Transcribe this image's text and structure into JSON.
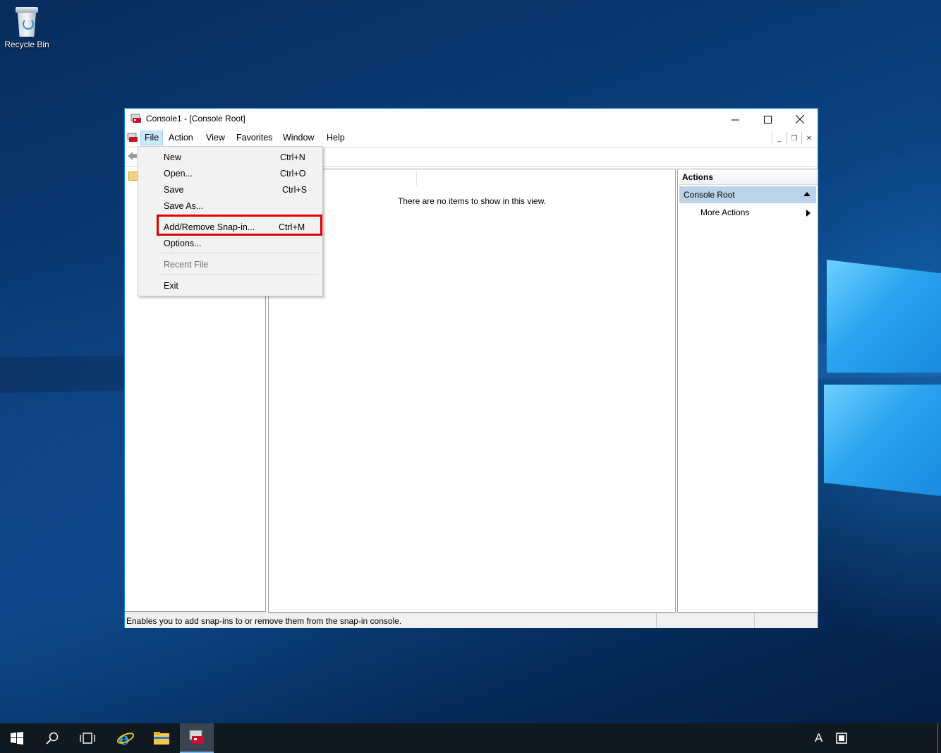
{
  "desktop": {
    "recycle_bin_label": "Recycle Bin"
  },
  "window": {
    "title": "Console1 - [Console Root]",
    "caption": {
      "minimize": "—",
      "maximize": "☐",
      "close": "✕"
    },
    "menu": [
      {
        "label": "File",
        "active": true
      },
      {
        "label": "Action"
      },
      {
        "label": "View"
      },
      {
        "label": "Favorites"
      },
      {
        "label": "Window"
      },
      {
        "label": "Help"
      }
    ],
    "empty_message": "There are no items to show in this view.",
    "actions": {
      "header": "Actions",
      "section": "Console Root",
      "more": "More Actions"
    },
    "status_text": "Enables you to add snap-ins to or remove them from the snap-in console."
  },
  "file_menu": {
    "items": [
      {
        "label": "New",
        "shortcut": "Ctrl+N"
      },
      {
        "label": "Open...",
        "shortcut": "Ctrl+O"
      },
      {
        "label": "Save",
        "shortcut": "Ctrl+S"
      },
      {
        "label": "Save As...",
        "shortcut": ""
      },
      {
        "label": "Add/Remove Snap-in...",
        "shortcut": "Ctrl+M",
        "highlighted": true
      },
      {
        "label": "Options...",
        "shortcut": ""
      },
      {
        "label": "Recent File",
        "shortcut": "",
        "disabled": true
      },
      {
        "label": "Exit",
        "shortcut": ""
      }
    ]
  },
  "taskbar": {
    "apps": [
      "start-icon",
      "search-icon",
      "task-view-icon",
      "internet-explorer-icon",
      "file-explorer-icon",
      "mmc-icon"
    ],
    "tray_ime": "A"
  },
  "colors": {
    "accent": "#1883d7",
    "highlight_box": "#e00000",
    "actions_section": "#bcd2e8",
    "menu_active": "#cce8ff"
  }
}
